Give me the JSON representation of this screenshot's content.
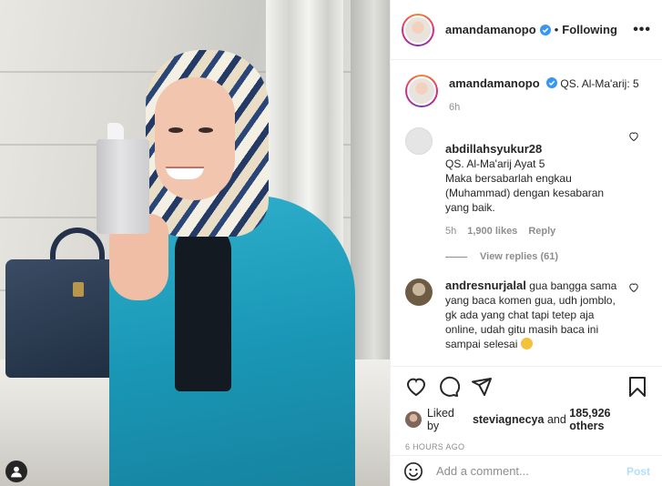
{
  "post_author": {
    "username": "amandamanopo",
    "follow_label": "Following",
    "more_label": "•••"
  },
  "caption": {
    "username": "amandamanopo",
    "text": "QS. Al-Ma'arij: 5",
    "time": "6h"
  },
  "comments": [
    {
      "username": "abdillahsyukur28",
      "text": "QS. Al-Ma'arij Ayat 5\nMaka bersabarlah engkau (Muhammad) dengan kesabaran yang baik.",
      "time": "5h",
      "likes": "1,900 likes",
      "reply_label": "Reply",
      "view_replies": "View replies (61)"
    },
    {
      "username": "andresnurjalal",
      "text": "gua bangga sama yang baca komen gua, udh jomblo, gk ada yang chat tapi tetep aja online, udah gitu masih baca ini sampai selesai"
    }
  ],
  "likes_row": {
    "prefix": "Liked by",
    "user": "steviagnecya",
    "and": "and",
    "count": "185,926 others"
  },
  "post_time": "6 HOURS AGO",
  "add_comment": {
    "placeholder": "Add a comment...",
    "post_label": "Post"
  },
  "colors": {
    "verified": "#3897f0",
    "post_button_disabled": "#b2dffc",
    "muted_text": "#8e8e8e"
  },
  "icons": [
    "user-tag-icon",
    "verified-icon",
    "heart-icon",
    "comment-icon",
    "share-icon",
    "bookmark-icon",
    "emoji-icon"
  ]
}
